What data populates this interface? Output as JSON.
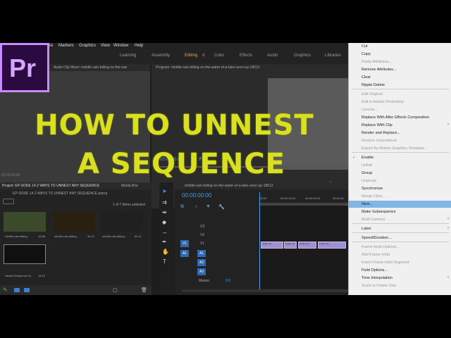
{
  "app": {
    "logo_text": "Pr",
    "menu": [
      "ze",
      "Markers",
      "Graphics",
      "View",
      "Window",
      "Help"
    ],
    "workspaces": [
      "Learning",
      "Assembly",
      "Editing",
      "Color",
      "Effects",
      "Audio",
      "Graphics",
      "Libraries"
    ],
    "active_workspace": "Editing",
    "workspace_menu_glyph": "≡"
  },
  "source_panel": {
    "header": "Audio Clip Mixer: middle-rain-falling-on-the-wat"
  },
  "program_panel": {
    "header": "Program: middle-rain-falling-on-the-water-of-a-lake-seen-up-18012",
    "timecode": "00:00:00:00",
    "fit_label": "Fit",
    "left_timecode": "00:00:00:00"
  },
  "title_overlay": {
    "line1": "HOW TO UNNEST",
    "line2": "A SEQUENCE"
  },
  "project_panel": {
    "tab_project": "Project: EP-SODE 14 2 WAYS TO UNNEST ANY SEQUENCE",
    "tab_media": "Media Brw",
    "path": "EP-SODE 14 2 WAYS TO UNNEST ANY SEQUENCE.prproj",
    "count": "1 of 7 items selected",
    "items": [
      {
        "name": "middle-rain-falling...",
        "duration": "15:48",
        "color": "#3a4a2a"
      },
      {
        "name": "middle-rain-falling...",
        "duration": "34:12",
        "color": "#2a2010"
      },
      {
        "name": "middle-rain-falling...",
        "duration": "50:11",
        "color": "#202020"
      },
      {
        "name": "Nested Sequence 01",
        "duration": "18:12",
        "color": "#101010"
      }
    ]
  },
  "timeline": {
    "header": "middle-rain-falling-on-the-water-of-a-lake-seen-up-18012",
    "timecode": "00:00:00:00",
    "ruler": [
      "00:00",
      "00:00:14:23",
      "00:00:29:23",
      "00:00:44"
    ],
    "tracks": [
      "V3",
      "V2",
      "V1",
      "A1",
      "A2",
      "A3",
      "Master"
    ],
    "master_value": "0.0",
    "clips": [
      "middle-rain",
      "middle-rain",
      "middle-rain",
      "middle-rain"
    ]
  },
  "context_menu": {
    "items": [
      {
        "label": "Cut",
        "disabled": false
      },
      {
        "label": "Copy",
        "disabled": false
      },
      {
        "label": "Paste Attributes...",
        "disabled": true
      },
      {
        "label": "Remove Attributes...",
        "disabled": false
      },
      {
        "label": "Clear",
        "disabled": false
      },
      {
        "label": "Ripple Delete",
        "disabled": false
      },
      {
        "label": "Edit Original",
        "disabled": true
      },
      {
        "label": "Edit in Adobe Photoshop",
        "disabled": true
      },
      {
        "label": "License...",
        "disabled": true
      },
      {
        "label": "Replace With After Effects Composition",
        "disabled": false
      },
      {
        "label": "Replace With Clip",
        "disabled": false
      },
      {
        "label": "Render and Replace...",
        "disabled": false
      },
      {
        "label": "Restore Unrendered",
        "disabled": true
      },
      {
        "label": "Export As Motion Graphics Template...",
        "disabled": true
      },
      {
        "label": "Enable",
        "disabled": false
      },
      {
        "label": "Unlink",
        "disabled": true
      },
      {
        "label": "Group",
        "disabled": false
      },
      {
        "label": "Ungroup",
        "disabled": true
      },
      {
        "label": "Synchronize",
        "disabled": false
      },
      {
        "label": "Merge Clips...",
        "disabled": true
      },
      {
        "label": "Nest...",
        "disabled": false
      },
      {
        "label": "Make Subsequence",
        "disabled": false
      },
      {
        "label": "Multi-Camera",
        "disabled": true
      },
      {
        "label": "Label",
        "disabled": false
      },
      {
        "label": "Speed/Duration...",
        "disabled": false
      },
      {
        "label": "Frame Hold Options...",
        "disabled": true
      },
      {
        "label": "Add Frame Hold",
        "disabled": true
      },
      {
        "label": "Insert Frame Hold Segment",
        "disabled": true
      },
      {
        "label": "Field Options...",
        "disabled": false
      },
      {
        "label": "Time Interpolation",
        "disabled": false
      },
      {
        "label": "Scale to Frame Size",
        "disabled": true
      }
    ],
    "checked": "Enable",
    "highlighted": "Nest...",
    "submenus": [
      "Replace With Clip",
      "Multi-Camera",
      "Label",
      "Time Interpolation"
    ]
  },
  "colors": {
    "accent_orange": "#e0a84b",
    "title_yellow": "#d8e021",
    "premiere_purple": "#c889ff",
    "clip_purple": "#9f8fd0",
    "menu_highlight": "#7fb6e6"
  }
}
